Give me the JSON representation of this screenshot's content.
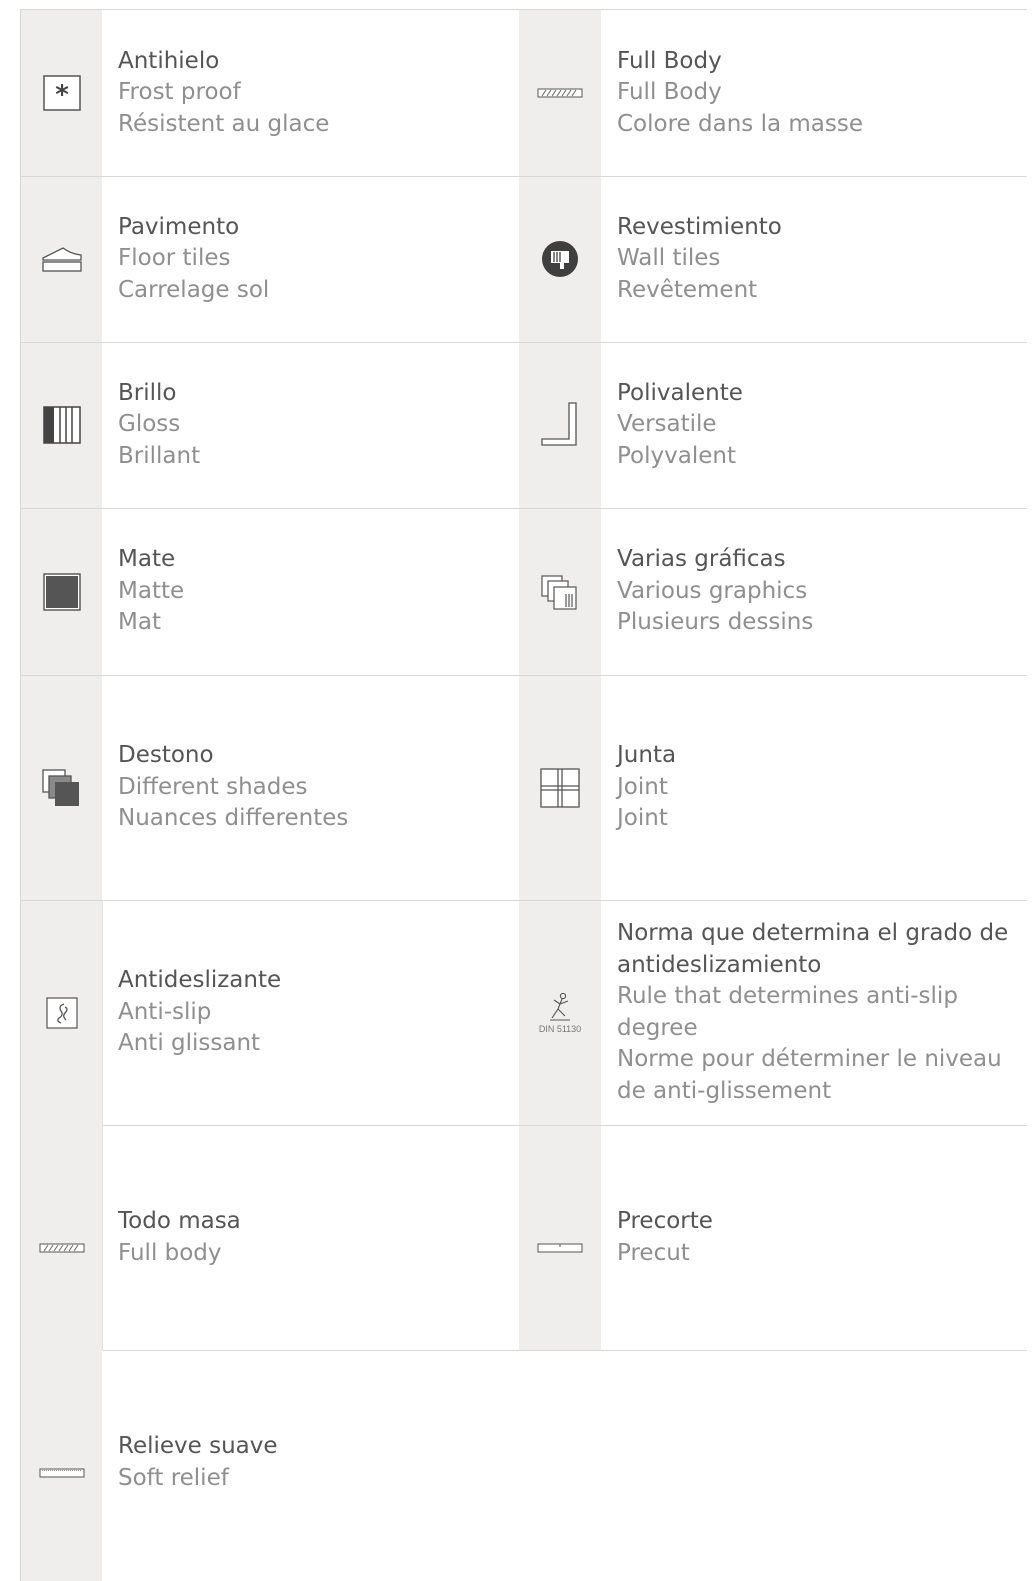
{
  "legend": [
    {
      "icon": "snowflake-icon",
      "primary": "Antihielo",
      "lines": [
        "Frost proof",
        "Résistent au glace"
      ]
    },
    {
      "icon": "full-body-icon",
      "primary": "Full Body",
      "lines": [
        "Full Body",
        "Colore dans la masse"
      ]
    },
    {
      "icon": "floor-tiles-icon",
      "primary": "Pavimento",
      "lines": [
        "Floor tiles",
        "Carrelage sol"
      ]
    },
    {
      "icon": "wall-tiles-icon",
      "primary": "Revestimiento",
      "lines": [
        "Wall tiles",
        "Revêtement"
      ]
    },
    {
      "icon": "gloss-icon",
      "primary": "Brillo",
      "lines": [
        "Gloss",
        "Brillant"
      ]
    },
    {
      "icon": "versatile-icon",
      "primary": "Polivalente",
      "lines": [
        "Versatile",
        "Polyvalent"
      ]
    },
    {
      "icon": "matte-icon",
      "primary": "Mate",
      "lines": [
        "Matte",
        "Mat"
      ]
    },
    {
      "icon": "various-graphics-icon",
      "primary": "Varias gráficas",
      "lines": [
        "Various graphics",
        "Plusieurs dessins"
      ]
    },
    {
      "icon": "different-shades-icon",
      "primary": "Destono",
      "lines": [
        "Different shades",
        "Nuances differentes"
      ]
    },
    {
      "icon": "joint-icon",
      "primary": "Junta",
      "lines": [
        "Joint",
        "Joint"
      ]
    },
    {
      "icon": "anti-slip-icon",
      "primary": "Antideslizante",
      "lines": [
        "Anti-slip",
        "Anti glissant"
      ]
    },
    {
      "icon": "din-standard-icon",
      "icon_label": "DIN 51130",
      "primary": "Norma que determina el grado de antideslizamiento",
      "lines": [
        "Rule that determines anti-slip degree",
        "Norme pour déterminer le niveau de anti-glissement"
      ]
    },
    {
      "icon": "full-body-icon",
      "primary": "Todo masa",
      "lines": [
        "Full body"
      ]
    },
    {
      "icon": "precut-icon",
      "primary": "Precorte",
      "lines": [
        "Precut"
      ]
    },
    {
      "icon": "soft-relief-icon",
      "primary": "Relieve suave",
      "lines": [
        "Soft relief"
      ]
    }
  ]
}
